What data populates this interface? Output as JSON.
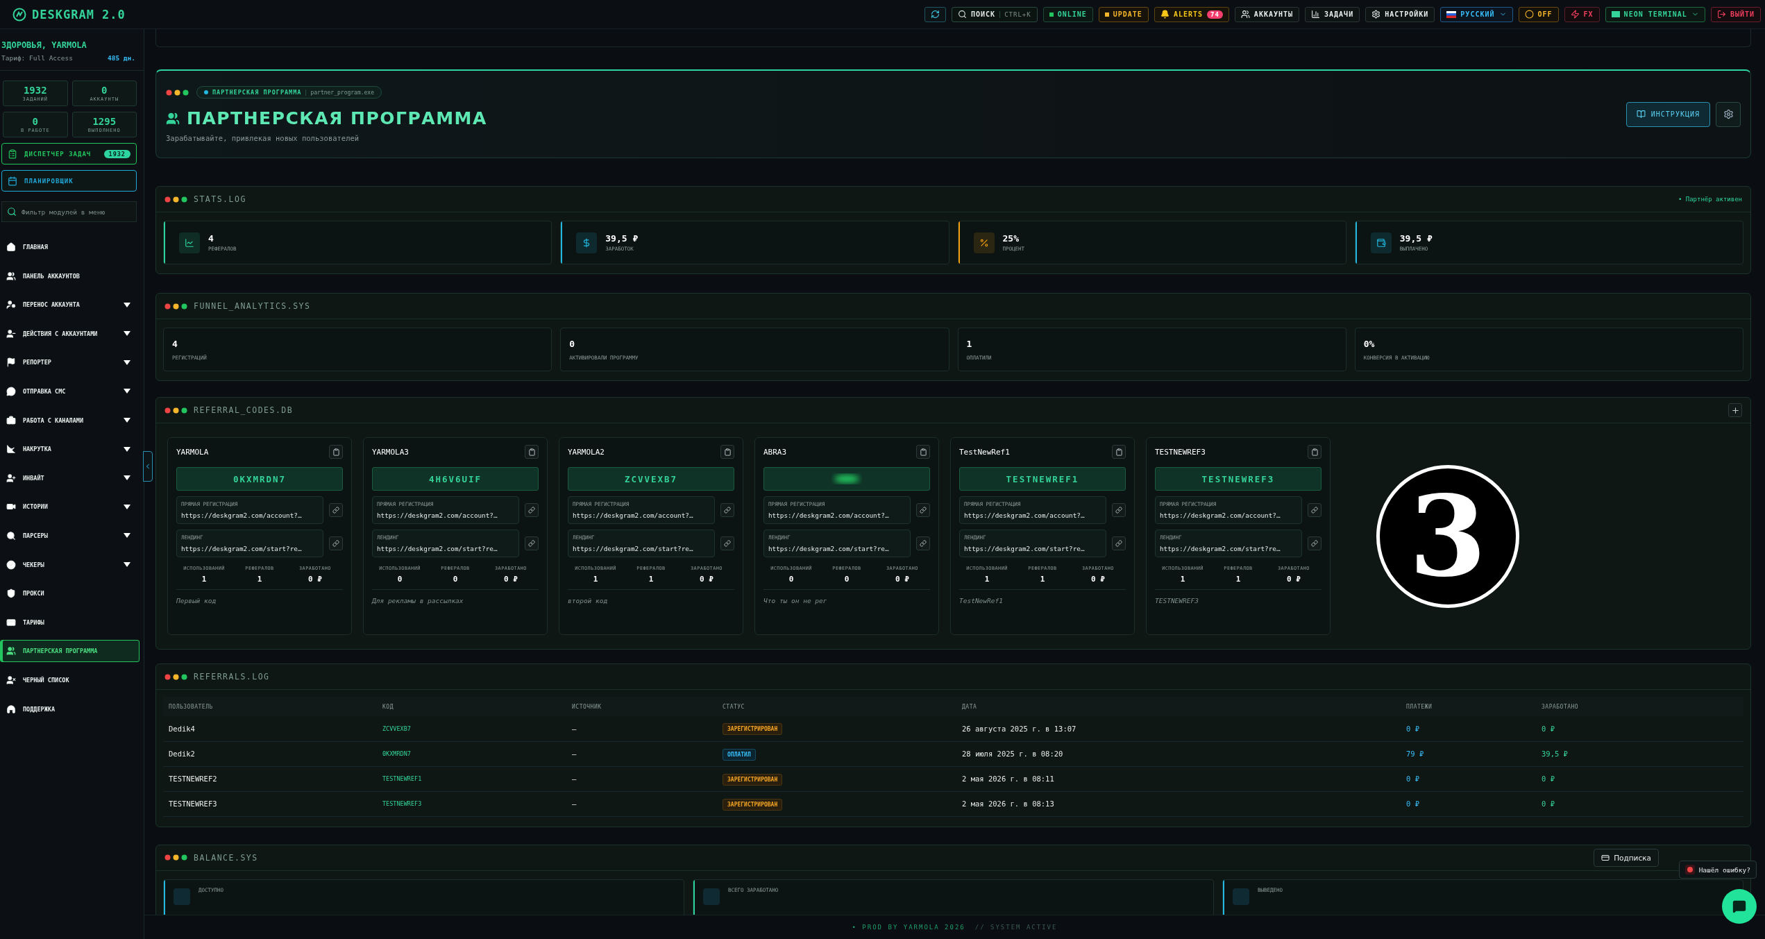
{
  "topbar": {
    "brand": "DESKGRAM 2.0",
    "items": [
      {
        "kind": "refresh"
      },
      {
        "kind": "search",
        "label": "ПОИСК",
        "shortcut": "CTRL+K"
      },
      {
        "kind": "status",
        "label": "ONLINE"
      },
      {
        "kind": "update",
        "label": "UPDATE"
      },
      {
        "kind": "alerts",
        "label": "ALERTS",
        "count": "74"
      },
      {
        "kind": "nav",
        "label": "АККАУНТЫ"
      },
      {
        "kind": "nav",
        "label": "ЗАДАЧИ"
      },
      {
        "kind": "nav",
        "label": "НАСТРОЙКИ"
      },
      {
        "kind": "language",
        "label": "РУССКИЙ"
      },
      {
        "kind": "power",
        "label": "OFF"
      },
      {
        "kind": "fx",
        "label": "FX"
      },
      {
        "kind": "theme",
        "label": "NEON TERMINAL"
      },
      {
        "kind": "logout",
        "label": "ВЫЙТИ"
      }
    ]
  },
  "sidebar": {
    "greeting": "ЗДОРОВЬЯ, YARMOLA",
    "plan": "Тариф: Full Access",
    "days": "485 дн.",
    "stats": [
      {
        "value": "1932",
        "label": "ЗАДАНИЙ"
      },
      {
        "value": "0",
        "label": "АККАУНТЫ"
      },
      {
        "value": "0",
        "label": "В РАБОТЕ"
      },
      {
        "value": "1295",
        "label": "ВЫПОЛНЕНО"
      }
    ],
    "dispatcher": {
      "label": "ДИСПЕТЧЕР ЗАДАЧ",
      "count": "1932"
    },
    "planner": {
      "label": "ПЛАНИРОВЩИК"
    },
    "filter": {
      "placeholder": "Фильтр модулей в меню"
    },
    "nav": [
      {
        "label": "ГЛАВНАЯ",
        "expandable": false,
        "selected": false
      },
      {
        "label": "ПАНЕЛЬ АККАУНТОВ",
        "expandable": false,
        "selected": false
      },
      {
        "label": "ПЕРЕНОС АККАУНТА",
        "expandable": true,
        "selected": false
      },
      {
        "label": "ДЕЙСТВИЯ С АККАУНТАМИ",
        "expandable": true,
        "selected": false
      },
      {
        "label": "РЕПОРТЕР",
        "expandable": true,
        "selected": false
      },
      {
        "label": "ОТПРАВКА СМС",
        "expandable": true,
        "selected": false
      },
      {
        "label": "РАБОТА С КАНАЛАМИ",
        "expandable": true,
        "selected": false
      },
      {
        "label": "НАКРУТКА",
        "expandable": true,
        "selected": false
      },
      {
        "label": "ИНВАЙТ",
        "expandable": true,
        "selected": false
      },
      {
        "label": "ИСТОРИИ",
        "expandable": true,
        "selected": false
      },
      {
        "label": "ПАРСЕРЫ",
        "expandable": true,
        "selected": false
      },
      {
        "label": "ЧЕКЕРЫ",
        "expandable": true,
        "selected": false
      },
      {
        "label": "ПРОКСИ",
        "expandable": false,
        "selected": false
      },
      {
        "label": "ТАРИФЫ",
        "expandable": false,
        "selected": false
      },
      {
        "label": "ПАРТНЕРСКАЯ ПРОГРАММА",
        "expandable": false,
        "selected": true
      },
      {
        "label": "ЧЕРНЫЙ СПИСОК",
        "expandable": false,
        "selected": false
      },
      {
        "label": "ПОДДЕРЖКА",
        "expandable": false,
        "selected": false
      }
    ]
  },
  "page_header": {
    "tag": "ПАРТНЕРСКАЯ ПРОГРАММА",
    "file": "partner_program.exe",
    "title": "ПАРТНЕРСКАЯ ПРОГРАММА",
    "subtitle": "Зарабатывайте, привлекая новых пользователей",
    "instruction_button": "ИНСТРУКЦИЯ"
  },
  "stats_log": {
    "title": "STATS.LOG",
    "status": "• Партнёр активен",
    "cards": [
      {
        "value": "4",
        "label": "РЕФЕРАЛОВ",
        "color": "#2dd4a0"
      },
      {
        "value": "39,5 ₽",
        "label": "ЗАРАБОТОК",
        "color": "#22b8e0"
      },
      {
        "value": "25%",
        "label": "ПРОЦЕНТ",
        "color": "#f59e0b"
      },
      {
        "value": "39,5 ₽",
        "label": "ВЫПЛАЧЕНО",
        "color": "#22b8e0"
      }
    ]
  },
  "funnel": {
    "title": "FUNNEL_ANALYTICS.SYS",
    "cards": [
      {
        "value": "4",
        "label": "РЕГИСТРАЦИЙ"
      },
      {
        "value": "0",
        "label": "АКТИВИРОВАЛИ ПРОГРАММУ"
      },
      {
        "value": "1",
        "label": "ОПЛАТИЛИ"
      },
      {
        "value": "0%",
        "label": "КОНВЕРСИЯ В АКТИВАЦИЮ"
      }
    ]
  },
  "referral_codes": {
    "title": "REFERRAL_CODES.DB",
    "cards": [
      {
        "name": "YARMOLA",
        "code": "0KXMRDN7",
        "blurred": false,
        "links": [
          {
            "label": "ПРЯМАЯ РЕГИСТРАЦИЯ",
            "url": "https://deskgram2.com/account?…"
          },
          {
            "label": "ЛЕНДИНГ",
            "url": "https://deskgram2.com/start?re…"
          }
        ],
        "stats": [
          {
            "label": "ИСПОЛЬЗОВАНИЙ",
            "value": "1"
          },
          {
            "label": "РЕФЕРАЛОВ",
            "value": "1"
          },
          {
            "label": "ЗАРАБОТАНО",
            "value": "0 ₽"
          }
        ],
        "note": "Первый код"
      },
      {
        "name": "YARMOLA3",
        "code": "4H6V6UIF",
        "blurred": false,
        "links": [
          {
            "label": "ПРЯМАЯ РЕГИСТРАЦИЯ",
            "url": "https://deskgram2.com/account?…"
          },
          {
            "label": "ЛЕНДИНГ",
            "url": "https://deskgram2.com/start?re…"
          }
        ],
        "stats": [
          {
            "label": "ИСПОЛЬЗОВАНИЙ",
            "value": "0"
          },
          {
            "label": "РЕФЕРАЛОВ",
            "value": "0"
          },
          {
            "label": "ЗАРАБОТАНО",
            "value": "0 ₽"
          }
        ],
        "note": "Для рекламы в рассылках"
      },
      {
        "name": "YARMOLA2",
        "code": "ZCVVEXB7",
        "blurred": false,
        "links": [
          {
            "label": "ПРЯМАЯ РЕГИСТРАЦИЯ",
            "url": "https://deskgram2.com/account?…"
          },
          {
            "label": "ЛЕНДИНГ",
            "url": "https://deskgram2.com/start?re…"
          }
        ],
        "stats": [
          {
            "label": "ИСПОЛЬЗОВАНИЙ",
            "value": "1"
          },
          {
            "label": "РЕФЕРАЛОВ",
            "value": "1"
          },
          {
            "label": "ЗАРАБОТАНО",
            "value": "0 ₽"
          }
        ],
        "note": "второй код"
      },
      {
        "name": "ABRA3",
        "blurred": true,
        "links": [
          {
            "label": "ПРЯМАЯ РЕГИСТРАЦИЯ",
            "url": "https://deskgram2.com/account?…"
          },
          {
            "label": "ЛЕНДИНГ",
            "url": "https://deskgram2.com/start?re…"
          }
        ],
        "stats": [
          {
            "label": "ИСПОЛЬЗОВАНИЙ",
            "value": "0"
          },
          {
            "label": "РЕФЕРАЛОВ",
            "value": "0"
          },
          {
            "label": "ЗАРАБОТАНО",
            "value": "0 ₽"
          }
        ],
        "note": "Что ты он не рег"
      },
      {
        "name": "TestNewRef1",
        "code": "TESTNEWREF1",
        "blurred": false,
        "links": [
          {
            "label": "ПРЯМАЯ РЕГИСТРАЦИЯ",
            "url": "https://deskgram2.com/account?…"
          },
          {
            "label": "ЛЕНДИНГ",
            "url": "https://deskgram2.com/start?re…"
          }
        ],
        "stats": [
          {
            "label": "ИСПОЛЬЗОВАНИЙ",
            "value": "1"
          },
          {
            "label": "РЕФЕРАЛОВ",
            "value": "1"
          },
          {
            "label": "ЗАРАБОТАНО",
            "value": "0 ₽"
          }
        ],
        "note": "TestNewRef1"
      },
      {
        "name": "TESTNEWREF3",
        "code": "TESTNEWREF3",
        "blurred": false,
        "links": [
          {
            "label": "ПРЯМАЯ РЕГИСТРАЦИЯ",
            "url": "https://deskgram2.com/account?…"
          },
          {
            "label": "ЛЕНДИНГ",
            "url": "https://deskgram2.com/start?re…"
          }
        ],
        "stats": [
          {
            "label": "ИСПОЛЬЗОВАНИЙ",
            "value": "1"
          },
          {
            "label": "РЕФЕРАЛОВ",
            "value": "1"
          },
          {
            "label": "ЗАРАБОТАНО",
            "value": "0 ₽"
          }
        ],
        "note": "TESTNEWREF3"
      }
    ]
  },
  "marker": "3",
  "referrals_log": {
    "title": "REFERRALS.LOG",
    "columns": [
      "ПОЛЬЗОВАТЕЛЬ",
      "КОД",
      "ИСТОЧНИК",
      "СТАТУС",
      "ДАТА",
      "ПЛАТЕЖИ",
      "ЗАРАБОТАНО"
    ],
    "rows": [
      {
        "user": "Dedik4",
        "code": "ZCVVEXB7",
        "source": "—",
        "status": {
          "label": "ЗАРЕГИСТРИРОВАН",
          "kind": "registered"
        },
        "date": "26 августа 2025 г. в 13:07",
        "payments": "0 ₽",
        "earned": "0 ₽"
      },
      {
        "user": "Dedik2",
        "code": "0KXMRDN7",
        "source": "—",
        "status": {
          "label": "ОПЛАТИЛ",
          "kind": "paid"
        },
        "date": "28 июля 2025 г. в 08:20",
        "payments": "79 ₽",
        "earned": "39,5 ₽"
      },
      {
        "user": "TESTNEWREF2",
        "code": "TESTNEWREF1",
        "source": "—",
        "status": {
          "label": "ЗАРЕГИСТРИРОВАН",
          "kind": "registered"
        },
        "date": "2 мая 2026 г. в 08:11",
        "payments": "0 ₽",
        "earned": "0 ₽"
      },
      {
        "user": "TESTNEWREF3",
        "code": "TESTNEWREF3",
        "source": "—",
        "status": {
          "label": "ЗАРЕГИСТРИРОВАН",
          "kind": "registered"
        },
        "date": "2 мая 2026 г. в 08:13",
        "payments": "0 ₽",
        "earned": "0 ₽"
      }
    ]
  },
  "balance": {
    "title": "BALANCE.SYS",
    "subscription_button": "Подписка",
    "cards": [
      {
        "label": "ДОСТУПНО",
        "color": "#22b8e0"
      },
      {
        "label": "ВСЕГО ЗАРАБОТАНО",
        "color": "#2dd4a0"
      },
      {
        "label": "ВЫВЕДЕНО",
        "color": "#22b8e0"
      }
    ]
  },
  "bug_report": "Нашёл ошибку?",
  "footer": {
    "left": "• PROD BY YARMOLA 2026",
    "right": "// SYSTEM ACTIVE"
  }
}
